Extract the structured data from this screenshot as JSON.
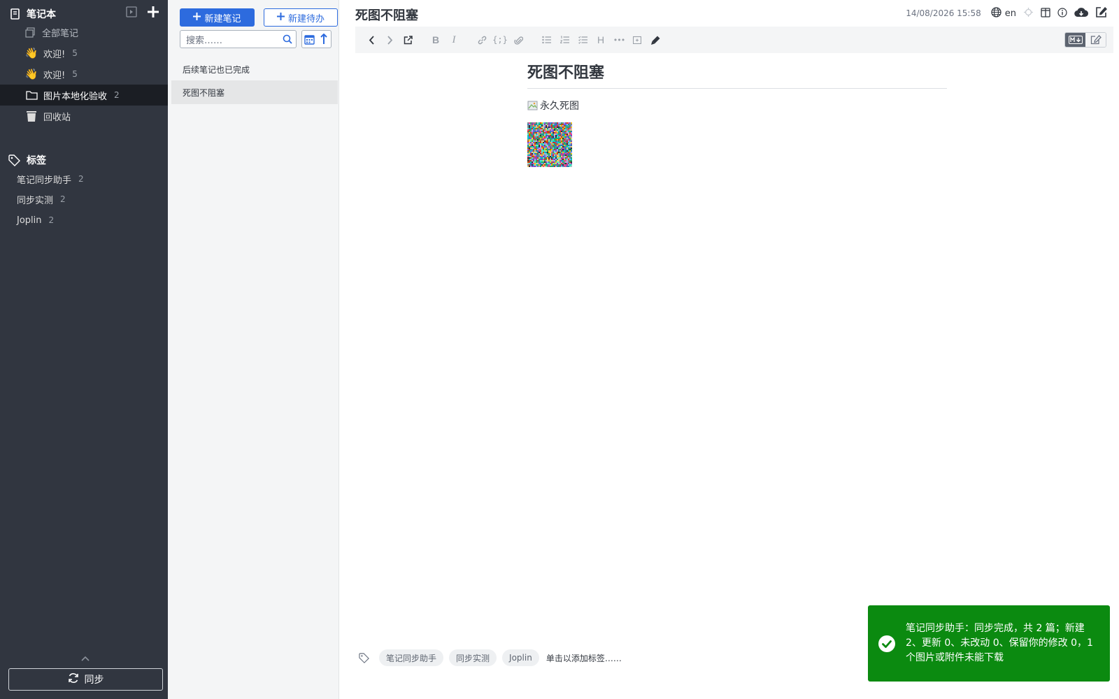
{
  "sidebar": {
    "notebooks_header": "笔记本",
    "all_notes": "全部笔记",
    "notebooks": [
      {
        "label": "欢迎!",
        "count": "5",
        "icon": "waving-hand-icon"
      },
      {
        "label": "欢迎!",
        "count": "5",
        "icon": "waving-hand-icon"
      },
      {
        "label": "图片本地化验收",
        "count": "2",
        "icon": "folder-icon",
        "selected": true
      }
    ],
    "trash": "回收站",
    "tags_header": "标签",
    "tags": [
      {
        "label": "笔记同步助手",
        "count": "2"
      },
      {
        "label": "同步实测",
        "count": "2"
      },
      {
        "label": "Joplin",
        "count": "2"
      }
    ],
    "sync_label": "同步"
  },
  "notelist": {
    "new_note": "新建笔记",
    "new_todo": "新建待办",
    "search_placeholder": "搜索……",
    "notes": [
      {
        "title": "后续笔记也已完成"
      },
      {
        "title": "死图不阻塞",
        "selected": true
      }
    ]
  },
  "editor": {
    "title": "死图不阻塞",
    "date": "14/08/2026 15:58",
    "lang": "en",
    "heading": "死图不阻塞",
    "broken_image_alt": "永久死图",
    "tags": [
      "笔记同步助手",
      "同步实测",
      "Joplin"
    ],
    "add_tags_hint": "单击以添加标签……"
  },
  "toast": {
    "text": "笔记同步助手：同步完成，共 2 篇；新建 2、更新 0、未改动 0、保留你的修改 0，1 个图片或附件未能下载"
  },
  "colors": {
    "sidebar_bg": "#313640",
    "sidebar_selected": "#1b1e24",
    "accent": "#2d6bde",
    "toast_bg": "#0b8a10"
  }
}
